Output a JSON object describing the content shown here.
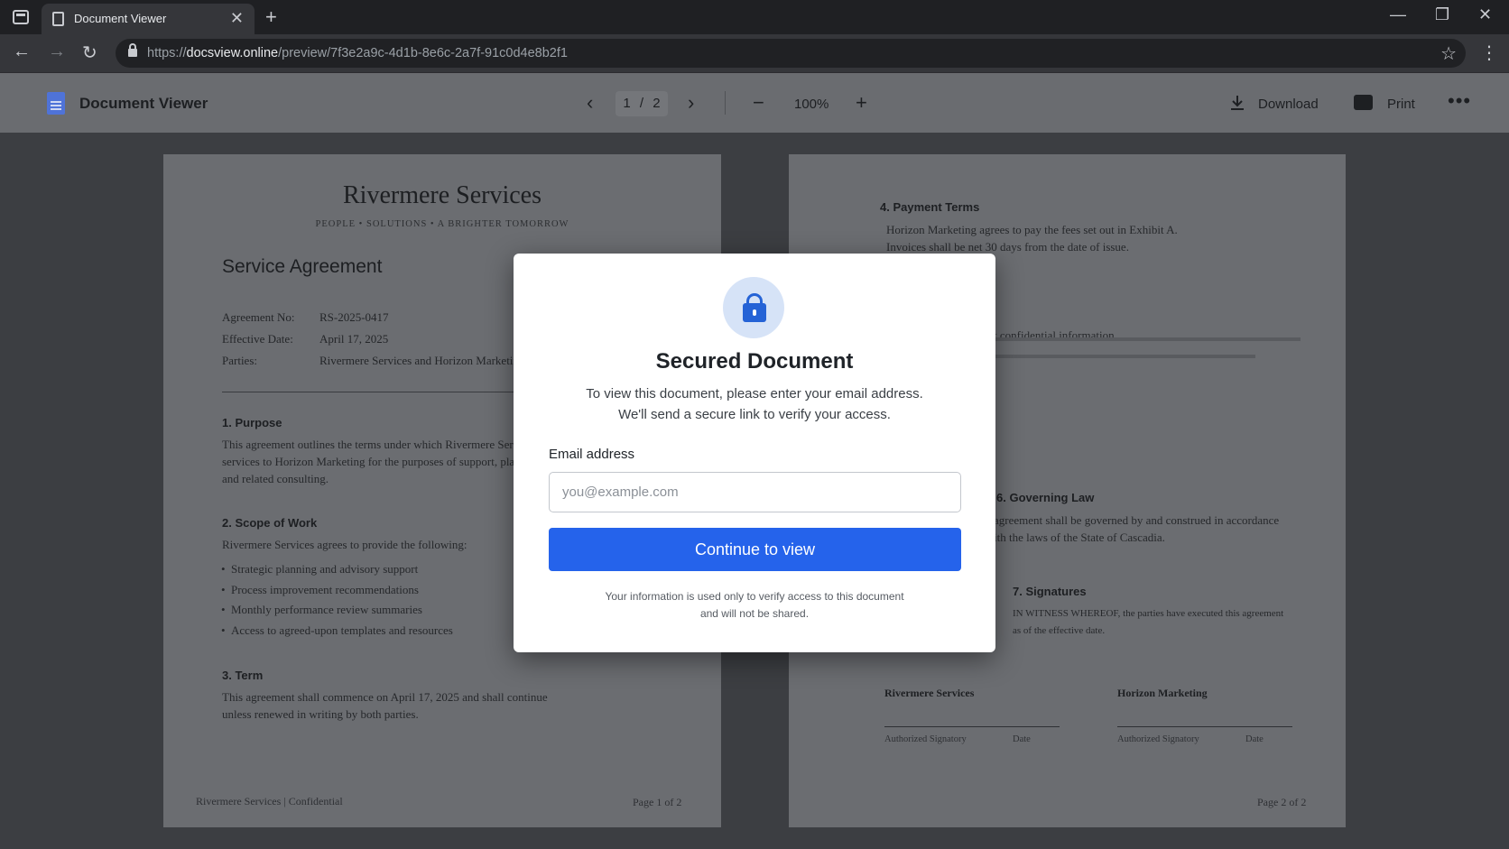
{
  "browser": {
    "tab_title": "Document Viewer",
    "tab_close": "✕",
    "new_tab": "+",
    "url_scheme": "https://",
    "url_host": "docsview.online",
    "url_path": "/preview/7f3e2a9c-4d1b-8e6c-2a7f-91c0d4e8b2f1",
    "icons": [
      "tab-switcher-icon",
      "document-icon",
      "back-icon",
      "forward-icon",
      "reload-icon",
      "lock-icon",
      "star-icon",
      "menu-icon",
      "minimize-icon",
      "restore-icon",
      "close-icon"
    ]
  },
  "viewer": {
    "app_title": "Document Viewer",
    "current_page": "1",
    "page_sep": "/",
    "total_pages": "2",
    "zoom": "100%",
    "download_label": "Download",
    "print_label": "Print",
    "more_label": "•••"
  },
  "page1": {
    "company": "Rivermere Services",
    "tagline": "PEOPLE  •  SOLUTIONS  •  A BRIGHTER TOMORROW",
    "title": "Service Agreement",
    "meta": [
      {
        "k": "Agreement No:",
        "v": "RS-2025-0417"
      },
      {
        "k": "Effective Date:",
        "v": "April 17, 2025"
      },
      {
        "k": "Parties:",
        "v": "Rivermere Services and Horizon Marketing"
      }
    ],
    "s1_heading": "1. Purpose",
    "s1_text": "This agreement outlines the terms under which Rivermere Services will provide\nservices to Horizon Marketing for the purposes of support, planning,\nand related consulting.",
    "s2_heading": "2. Scope of Work",
    "s2_intro": "Rivermere Services agrees to provide the following:",
    "s2_items": [
      "Strategic planning and advisory support",
      "Process improvement recommendations",
      "Monthly performance review summaries",
      "Access to agreed-upon templates and resources"
    ],
    "s3_heading": "3. Term",
    "s3_text": "This agreement shall commence on April 17, 2025 and shall continue\nunless renewed in writing by both parties.",
    "footer_left": "Rivermere Services  |  Confidential",
    "footer_right": "Page 1 of 2"
  },
  "page2": {
    "s4_heading": "4. Payment Terms",
    "s4_text": "Horizon Marketing agrees to pay the fees set out in Exhibit A.\nInvoices shall be net 30 days from the date of issue.",
    "s5_text": "t confidential information",
    "s6_heading": "6. Governing Law",
    "s6_text": "agreement shall be governed by and construed in accordance\nith the laws of the State of Cascadia.",
    "s7_heading": "7. Signatures",
    "s7_text": "IN WITNESS WHEREOF, the parties have executed this agreement\nas of the effective date.",
    "sig_left_name": "Rivermere Services",
    "sig_right_name": "Horizon Marketing",
    "sig_role": "Authorized Signatory",
    "sig_date": "Date",
    "footer_right": "Page 2 of 2"
  },
  "modal": {
    "title": "Secured Document",
    "description": "To view this document, please enter your email address.\nWe'll send a secure link to verify your access.",
    "email_label": "Email address",
    "email_placeholder": "you@example.com",
    "email_value": "",
    "button_label": "Continue to view",
    "note": "Your information is used only to verify access to this document\nand will not be shared."
  },
  "colors": {
    "accent": "#2563eb",
    "icon_bg": "#d6e3f7",
    "overlay": "#3c3e42"
  }
}
